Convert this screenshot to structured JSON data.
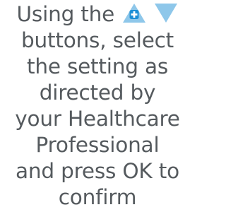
{
  "instruction": {
    "line1_text": "Using the",
    "line2": "buttons, select",
    "line3": "the setting as",
    "line4": "directed by",
    "line5": "your Healthcare",
    "line6": "Professional",
    "line7": "and press OK to",
    "line8": "confirm"
  },
  "icons": {
    "plus": {
      "name": "plus-up-triangle-icon",
      "triangle_color": "#8ec7ea",
      "badge_color": "#1d8fd6",
      "symbol": "+"
    },
    "minus": {
      "name": "down-triangle-icon",
      "triangle_color": "#8ec7ea"
    }
  },
  "colors": {
    "text": "#555a5e",
    "background": "#ffffff"
  }
}
